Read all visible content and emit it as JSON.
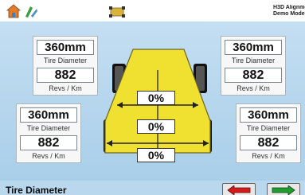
{
  "brand": {
    "line1": "H3D Alignment",
    "line2": "Demo Mode"
  },
  "icons": {
    "home": "home-icon",
    "tool": "tool-icon",
    "car": "car-icon",
    "back": "back-arrow-icon",
    "next": "next-arrow-icon"
  },
  "cards": {
    "front_left": {
      "diameter": "360mm",
      "diameter_label": "Tire Diameter",
      "revs": "882",
      "revs_unit": "Revs / Km"
    },
    "front_right": {
      "diameter": "360mm",
      "diameter_label": "Tire Diameter",
      "revs": "882",
      "revs_unit": "Revs / Km"
    },
    "rear_left": {
      "diameter": "360mm",
      "diameter_label": "Tire Diameter",
      "revs": "882",
      "revs_unit": "Revs / Km"
    },
    "rear_right": {
      "diameter": "360mm",
      "diameter_label": "Tire Diameter",
      "revs": "882",
      "revs_unit": "Revs / Km"
    }
  },
  "diagram": {
    "front_pct": "0%",
    "middle_pct": "0%",
    "rear_pct": "0%",
    "fill_color": "#f0e130",
    "tire_color": "#111111"
  },
  "footer": {
    "title": "Tire Diameter",
    "back_color": "#d51a1a",
    "next_color": "#1f9d2e"
  }
}
